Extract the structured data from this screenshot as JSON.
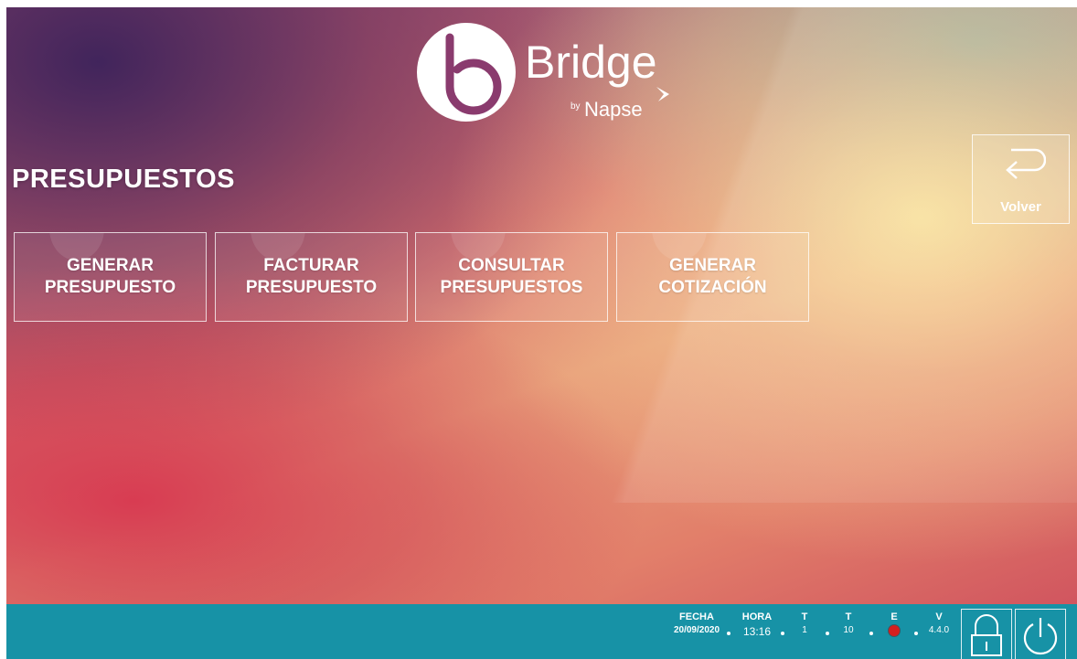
{
  "brand": {
    "name": "Bridge",
    "by": "by",
    "company": "Napse"
  },
  "page": {
    "title": "PRESUPUESTOS"
  },
  "actions": [
    {
      "label": "GENERAR\nPRESUPUESTO"
    },
    {
      "label": "FACTURAR\nPRESUPUESTO"
    },
    {
      "label": "CONSULTAR\nPRESUPUESTOS"
    },
    {
      "label": "GENERAR\nCOTIZACIÓN"
    }
  ],
  "back": {
    "label": "Volver",
    "icon": "return-arrow-icon"
  },
  "status": {
    "fecha": {
      "label": "FECHA",
      "value": "20/09/2020"
    },
    "hora": {
      "label": "HORA",
      "value": "13:16"
    },
    "t1": {
      "label": "T",
      "value": "1"
    },
    "t2": {
      "label": "T",
      "value": "10"
    },
    "e": {
      "label": "E",
      "color": "#d41f1f"
    },
    "v": {
      "label": "V",
      "value": "4.4.0"
    },
    "lock_icon": "lock-icon",
    "power_icon": "power-icon"
  },
  "colors": {
    "statusbar": "#1792a6",
    "accent_white": "#ffffff"
  }
}
